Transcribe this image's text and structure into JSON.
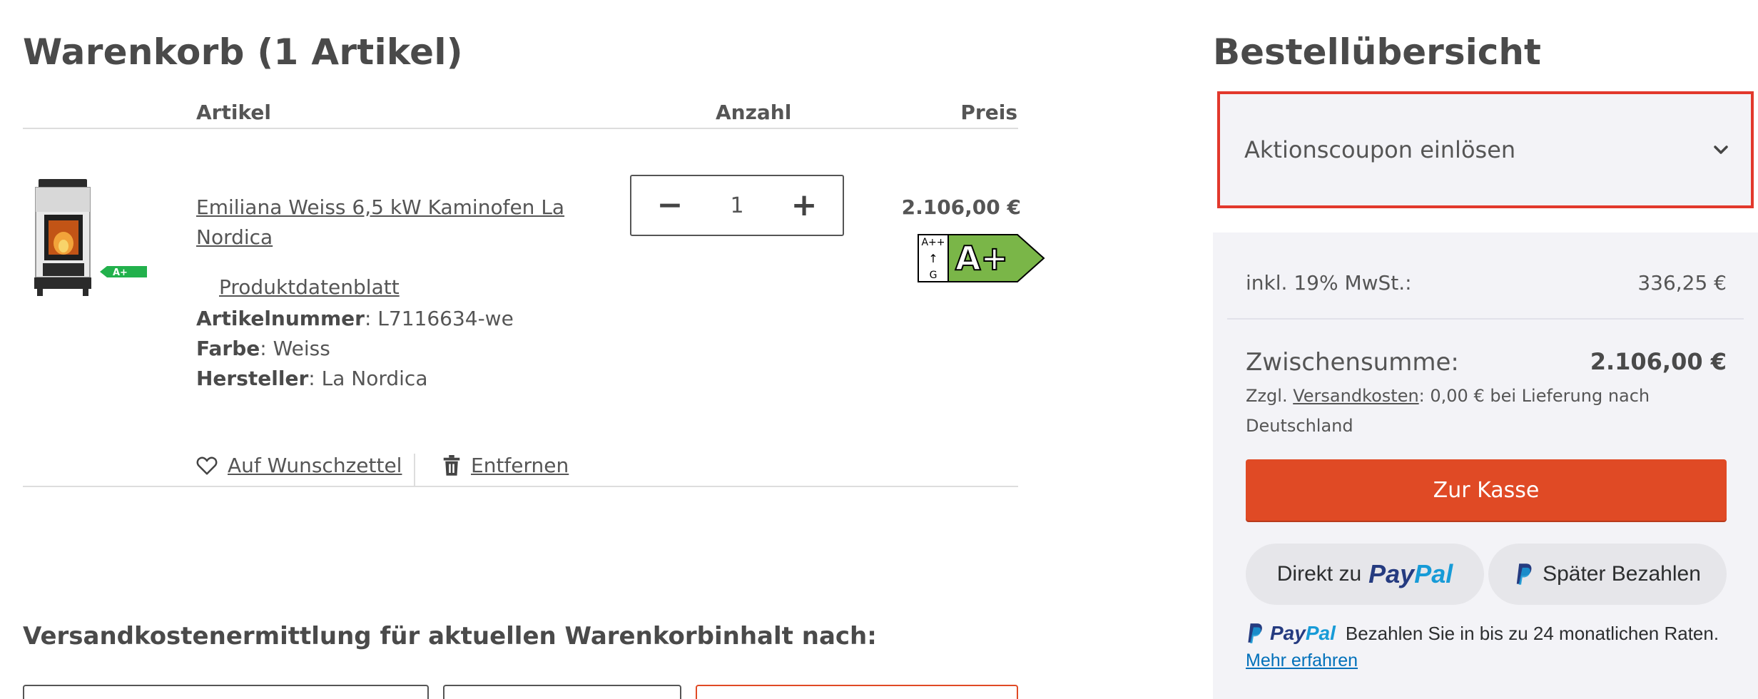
{
  "cart": {
    "title": "Warenkorb (1 Artikel)",
    "columns": {
      "article": "Artikel",
      "quantity": "Anzahl",
      "price": "Preis"
    },
    "item": {
      "name": "Emiliana Weiss 6,5 kW Kaminofen La Nordica",
      "image_badge": "A+",
      "datasheet_link": "Produktdatenblatt",
      "attributes": [
        {
          "label": "Artikelnummer",
          "value": "L7116634-we"
        },
        {
          "label": "Farbe",
          "value": "Weiss"
        },
        {
          "label": "Hersteller",
          "value": "La Nordica"
        }
      ],
      "quantity": "1",
      "price": "2.106,00 €",
      "energy_label": {
        "range_top": "A++",
        "range_arrow": "↑",
        "range_bottom": "G",
        "class": "A+"
      }
    },
    "actions": {
      "wishlist": "Auf Wunschzettel",
      "remove": "Entfernen"
    },
    "shipping_title": "Versandkostenermittlung für aktuellen Warenkorbinhalt nach:"
  },
  "summary": {
    "title": "Bestellübersicht",
    "coupon_label": "Aktionscoupon einlösen",
    "vat_label": "inkl. 19% MwSt.:",
    "vat_value": "336,25 €",
    "subtotal_label": "Zwischensumme:",
    "subtotal_value": "2.106,00 €",
    "shipping_prefix": "Zzgl. ",
    "shipping_link": "Versandkosten",
    "shipping_suffix": ": 0,00 € bei Lieferung nach Deutschland",
    "checkout_label": "Zur Kasse",
    "paypal_direct_prefix": "Direkt zu",
    "paypal_word_1": "Pay",
    "paypal_word_2": "Pal",
    "paypal_later_label": "Später Bezahlen",
    "paypal_info_text": "Bezahlen Sie in bis zu 24 monatlichen Raten.",
    "paypal_learn_more": "Mehr erfahren"
  },
  "colors": {
    "accent": "#e04a25",
    "highlight": "#e2382c",
    "energy_green": "#7ab648",
    "paypal_dark": "#253b80",
    "paypal_light": "#179bd7"
  }
}
